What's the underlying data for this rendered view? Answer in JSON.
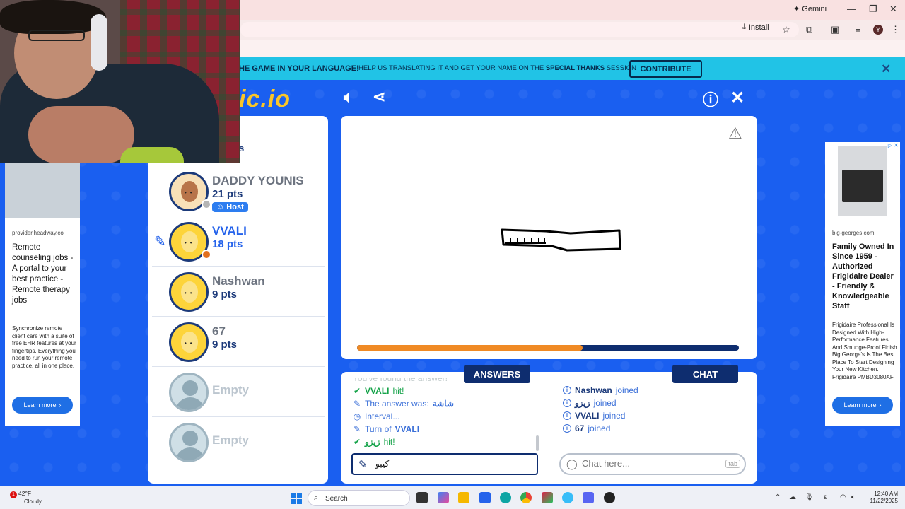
{
  "browser": {
    "gemini_label": "Gemini",
    "install_label": "Install",
    "profile_initial": "Y"
  },
  "banner": {
    "bold_text": "HE GAME IN YOUR LANGUAGE!",
    "text_before": "HELP US TRANSLATING IT AND GET YOUR NAME ON THE",
    "link_text": "SPECIAL THANKS",
    "text_after": "SESSION",
    "contribute_label": "CONTRIBUTE"
  },
  "game": {
    "logo_text": "ic.io",
    "players_header": "s",
    "players": [
      {
        "name": "DADDY YOUNIS",
        "points": "21 pts",
        "badge": "Host",
        "status_color": "#b5b5b5"
      },
      {
        "name": "VVALI",
        "points": "18 pts",
        "status_color": "#e2701d"
      },
      {
        "name": "Nashwan",
        "points": "9 pts"
      },
      {
        "name": "67",
        "points": "9 pts"
      },
      {
        "name": "Empty"
      },
      {
        "name": "Empty"
      }
    ],
    "timer_fraction": 0.59
  },
  "answers": {
    "tab_label": "ANSWERS",
    "items": [
      {
        "type": "faded",
        "text": "You've found the answer!"
      },
      {
        "type": "green",
        "icon": "check-icon",
        "bold": "VVALI",
        "text": "hit!"
      },
      {
        "type": "blue",
        "icon": "pencil-icon",
        "text": "The answer was:",
        "bold": "شاشة"
      },
      {
        "type": "blue",
        "icon": "clock-icon",
        "text": "Interval..."
      },
      {
        "type": "blue",
        "icon": "pencil-icon",
        "text": "Turn of",
        "bold": "VVALI"
      },
      {
        "type": "green",
        "icon": "check-icon",
        "bold": "زيزو",
        "text": "hit!"
      }
    ],
    "input_value": "كيبو"
  },
  "chat": {
    "tab_label": "CHAT",
    "items": [
      {
        "name": "Nashwan",
        "text": "joined"
      },
      {
        "name": "زيزو",
        "text": "joined"
      },
      {
        "name": "VVALI",
        "text": "joined"
      },
      {
        "name": "67",
        "text": "joined"
      }
    ],
    "placeholder": "Chat here...",
    "tab_hint": "tab"
  },
  "ad_left": {
    "source": "provider.headway.co",
    "title": "Remote counseling jobs - A portal to your best practice - Remote therapy jobs",
    "body": "Synchronize remote client care with a suite of free EHR features at your fingertips. Everything you need to run your remote practice, all in one place.",
    "button": "Learn more"
  },
  "ad_right": {
    "source": "big-georges.com",
    "title": "Family Owned In Since 1959 - Authorized Frigidaire Dealer - Friendly & Knowledgeable Staff",
    "body": "Frigidaire Professional Is Designed With High-Performance Features And Smudge-Proof Finish. Big George's Is The Best Place To Start Designing Your New Kitchen. Frigidaire PMBD3080AF",
    "button": "Learn more"
  },
  "taskbar": {
    "temperature": "42°F",
    "condition": "Cloudy",
    "notification_count": "1",
    "search_label": "Search",
    "time": "12:40 AM",
    "date": "11/22/2025"
  },
  "colors": {
    "accent_blue": "#1a5ff0",
    "navy": "#0e2d6f",
    "banner": "#21c3e6",
    "timer": "#f08a24"
  }
}
